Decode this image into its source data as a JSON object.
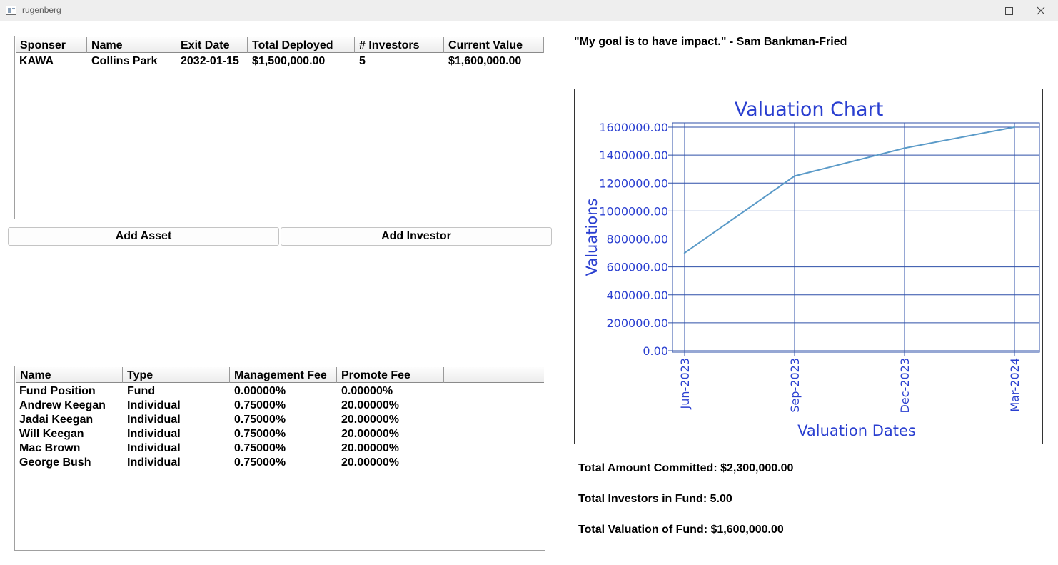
{
  "window": {
    "title": "rugenberg"
  },
  "assets_table": {
    "columns": [
      "Sponser",
      "Name",
      "Exit Date",
      "Total Deployed",
      "# Investors",
      "Current Value"
    ],
    "rows": [
      [
        "KAWA",
        "Collins Park",
        "2032-01-15",
        "$1,500,000.00",
        "5",
        "$1,600,000.00"
      ]
    ]
  },
  "buttons": {
    "add_asset": "Add Asset",
    "add_investor": "Add Investor"
  },
  "quote": "\"My goal is to have impact.\" - Sam Bankman-Fried",
  "investors_table": {
    "columns": [
      "Name",
      "Type",
      "Management Fee",
      "Promote Fee"
    ],
    "rows": [
      [
        "Fund Position",
        "Fund",
        "0.00000%",
        "0.00000%"
      ],
      [
        "Andrew Keegan",
        "Individual",
        "0.75000%",
        "20.00000%"
      ],
      [
        "Jadai Keegan",
        "Individual",
        "0.75000%",
        "20.00000%"
      ],
      [
        "Will Keegan",
        "Individual",
        "0.75000%",
        "20.00000%"
      ],
      [
        "Mac Brown",
        "Individual",
        "0.75000%",
        "20.00000%"
      ],
      [
        "George Bush",
        "Individual",
        "0.75000%",
        "20.00000%"
      ]
    ]
  },
  "chart_data": {
    "type": "line",
    "title": "Valuation Chart",
    "xlabel": "Valuation Dates",
    "ylabel": "Valuations",
    "x": [
      "Jun-2023",
      "Sep-2023",
      "Dec-2023",
      "Mar-2024"
    ],
    "values": [
      700000,
      1250000,
      1450000,
      1600000
    ],
    "ylim": [
      0,
      1600000
    ],
    "yticks": [
      "0.00",
      "200000.00",
      "400000.00",
      "600000.00",
      "800000.00",
      "1000000.00",
      "1200000.00",
      "1400000.00",
      "1600000.00"
    ],
    "grid": true,
    "text_color": "#2a3fd0",
    "grid_color": "#2d4fa8",
    "line_color": "#5a9ac8"
  },
  "summary": {
    "committed": "Total Amount Committed: $2,300,000.00",
    "investors": "Total Investors in Fund: 5.00",
    "valuation": "Total Valuation of Fund: $1,600,000.00"
  }
}
